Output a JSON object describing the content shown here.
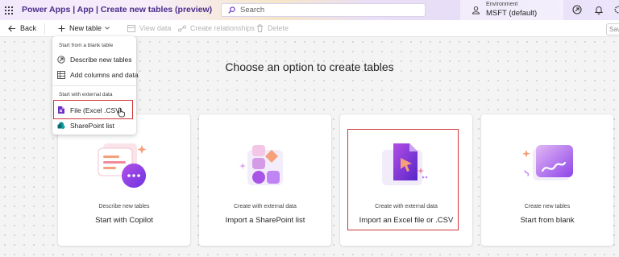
{
  "header": {
    "app_title": "Power Apps  |  App  |  Create new tables (preview)",
    "search_placeholder": "Search",
    "environment_label": "Environment",
    "environment_value": "MSFT (default)",
    "icons": [
      "waffle-icon",
      "environment-icon",
      "copilot-icon",
      "bell-icon",
      "settings-icon"
    ]
  },
  "commandbar": {
    "back": "Back",
    "new_table": "New table",
    "view_data": "View data",
    "create_relationships": "Create relationships",
    "delete": "Delete",
    "save_partial": "Sav"
  },
  "menu": {
    "group_blank": "Start from a blank table",
    "describe": "Describe new tables",
    "add_columns": "Add columns and data",
    "group_external": "Start with external data",
    "file": "File (Excel .CSV)",
    "sharepoint": "SharePoint list"
  },
  "main": {
    "heading": "Choose an option to create tables",
    "cards": [
      {
        "subtitle": "Describe new tables",
        "title": "Start with Copilot"
      },
      {
        "subtitle": "Create with external data",
        "title": "Import a SharePoint list"
      },
      {
        "subtitle": "Create with external data",
        "title": "Import an Excel file or .CSV"
      },
      {
        "subtitle": "Create new tables",
        "title": "Start from blank"
      }
    ]
  },
  "colors": {
    "accent_purple": "#6b2fbf",
    "highlight_red": "#d13438"
  }
}
